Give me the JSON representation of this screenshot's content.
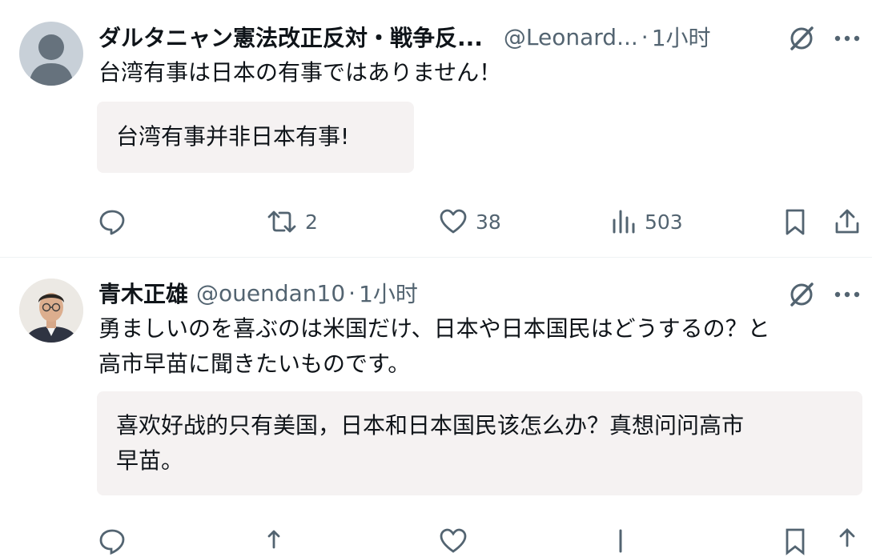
{
  "posts": [
    {
      "author_name": "ダルタニャン憲法改正反対・戦争反...",
      "handle": "@Leonard...",
      "time": "1小时",
      "text": "台湾有事は日本の有事ではありません！",
      "translation": "台湾有事并非日本有事!",
      "stats": {
        "reposts": "2",
        "likes": "38",
        "views": "503"
      }
    },
    {
      "author_name": "青木正雄",
      "handle": "@ouendan10",
      "time": "1小时",
      "text_lines": [
        "勇ましいのを喜ぶのは米国だけ、日本や日本国民はどうするの？と",
        "高市早苗に聞きたいものです。"
      ],
      "translation_lines": [
        "喜欢好战的只有美国，日本和日本国民该怎么办？真想问问高市",
        "早苗。"
      ]
    }
  ],
  "separator": "·",
  "colors": {
    "text": "#0f1419",
    "secondary": "#536471",
    "translation_bg": "#f5f2f2",
    "divider": "#eff3f4"
  },
  "icons": [
    "grok-icon",
    "more-icon",
    "reply-icon",
    "repost-icon",
    "like-icon",
    "views-icon",
    "bookmark-icon",
    "share-icon"
  ]
}
